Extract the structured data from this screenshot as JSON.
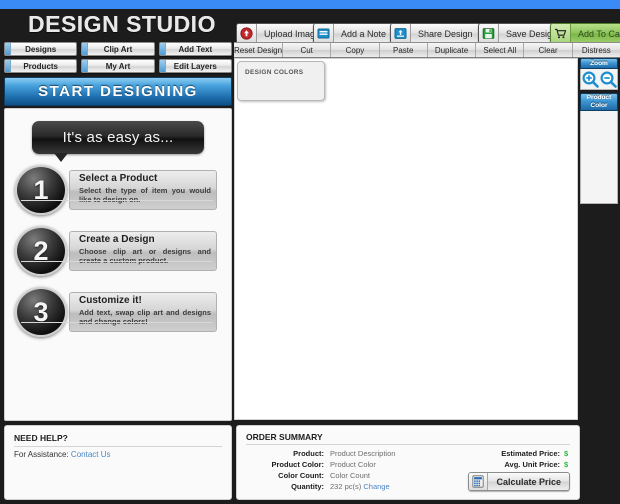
{
  "app": {
    "title": "DESIGN STUDIO",
    "accent_blue": "#3a8bf5",
    "header_bg": "#1c1c1c"
  },
  "toolbar": {
    "buttons": [
      {
        "label": "Upload Image",
        "icon": "upload-arrow-icon"
      },
      {
        "label": "Add a Note",
        "icon": "note-icon"
      },
      {
        "label": "Share Design",
        "icon": "share-icon"
      },
      {
        "label": "Save Design",
        "icon": "floppy-disk-icon"
      },
      {
        "label": "Add To Cart",
        "icon": "shopping-cart-icon"
      }
    ]
  },
  "leftnav": {
    "row1": [
      {
        "label": "Designs"
      },
      {
        "label": "Clip Art"
      },
      {
        "label": "Add Text"
      }
    ],
    "row2": [
      {
        "label": "Products"
      },
      {
        "label": "My Art"
      },
      {
        "label": "Edit Layers"
      }
    ]
  },
  "start": {
    "banner": "START  DESIGNING",
    "bubble": "It's as easy as..."
  },
  "steps": [
    {
      "number": "1",
      "title": "Select a Product",
      "desc": "Select the type of item you would like to design on."
    },
    {
      "number": "2",
      "title": "Create a Design",
      "desc": "Choose clip art or designs and create a custom product."
    },
    {
      "number": "3",
      "title": "Customize it!",
      "desc": "Add text, swap clip art and designs and change colors!"
    }
  ],
  "need_help": {
    "title": "NEED HELP?",
    "prefix": "For Assistance:",
    "link": "Contact Us"
  },
  "edit_toolbar": {
    "items": [
      {
        "label": "Reset Design"
      },
      {
        "label": "Cut"
      },
      {
        "label": "Copy"
      },
      {
        "label": "Paste"
      },
      {
        "label": "Duplicate"
      },
      {
        "label": "Select All"
      },
      {
        "label": "Clear"
      },
      {
        "label": "Distress"
      }
    ]
  },
  "canvas": {
    "design_colors_label": "DESIGN COLORS"
  },
  "rail": {
    "zoom_title": "Zoom",
    "zoom_in_icon": "magnifier-plus-icon",
    "zoom_out_icon": "magnifier-minus-icon",
    "product_color_line1": "Product",
    "product_color_line2": "Color"
  },
  "order_summary": {
    "title": "ORDER SUMMARY",
    "rows": [
      {
        "label": "Product:",
        "value": "Product Description"
      },
      {
        "label": "Product Color:",
        "value": "Product Color"
      },
      {
        "label": "Color Count:",
        "value": "Color Count"
      },
      {
        "label": "Quantity:",
        "value": "232 pc(s)",
        "link": "Change"
      }
    ],
    "right_rows": [
      {
        "label": "Estimated Price:",
        "value": "$"
      },
      {
        "label": "Avg. Unit Price:",
        "value": "$"
      }
    ],
    "calculate_label": "Calculate Price",
    "calculate_icon": "calculator-icon",
    "price_color": "#2cb742"
  }
}
